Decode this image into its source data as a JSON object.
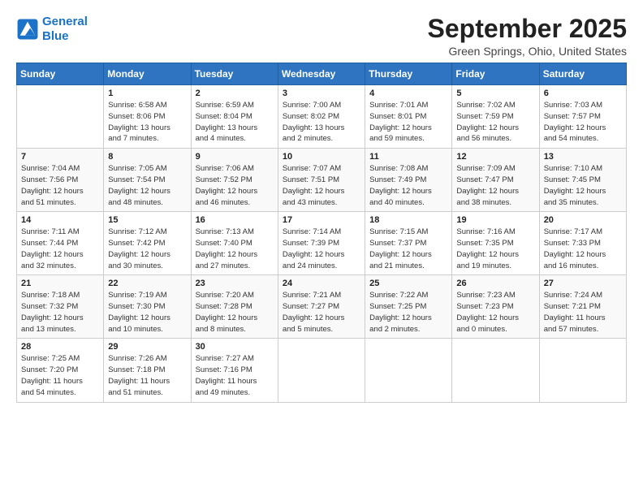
{
  "logo": {
    "line1": "General",
    "line2": "Blue"
  },
  "title": "September 2025",
  "subtitle": "Green Springs, Ohio, United States",
  "weekdays": [
    "Sunday",
    "Monday",
    "Tuesday",
    "Wednesday",
    "Thursday",
    "Friday",
    "Saturday"
  ],
  "weeks": [
    [
      {
        "day": "",
        "info": ""
      },
      {
        "day": "1",
        "info": "Sunrise: 6:58 AM\nSunset: 8:06 PM\nDaylight: 13 hours\nand 7 minutes."
      },
      {
        "day": "2",
        "info": "Sunrise: 6:59 AM\nSunset: 8:04 PM\nDaylight: 13 hours\nand 4 minutes."
      },
      {
        "day": "3",
        "info": "Sunrise: 7:00 AM\nSunset: 8:02 PM\nDaylight: 13 hours\nand 2 minutes."
      },
      {
        "day": "4",
        "info": "Sunrise: 7:01 AM\nSunset: 8:01 PM\nDaylight: 12 hours\nand 59 minutes."
      },
      {
        "day": "5",
        "info": "Sunrise: 7:02 AM\nSunset: 7:59 PM\nDaylight: 12 hours\nand 56 minutes."
      },
      {
        "day": "6",
        "info": "Sunrise: 7:03 AM\nSunset: 7:57 PM\nDaylight: 12 hours\nand 54 minutes."
      }
    ],
    [
      {
        "day": "7",
        "info": "Sunrise: 7:04 AM\nSunset: 7:56 PM\nDaylight: 12 hours\nand 51 minutes."
      },
      {
        "day": "8",
        "info": "Sunrise: 7:05 AM\nSunset: 7:54 PM\nDaylight: 12 hours\nand 48 minutes."
      },
      {
        "day": "9",
        "info": "Sunrise: 7:06 AM\nSunset: 7:52 PM\nDaylight: 12 hours\nand 46 minutes."
      },
      {
        "day": "10",
        "info": "Sunrise: 7:07 AM\nSunset: 7:51 PM\nDaylight: 12 hours\nand 43 minutes."
      },
      {
        "day": "11",
        "info": "Sunrise: 7:08 AM\nSunset: 7:49 PM\nDaylight: 12 hours\nand 40 minutes."
      },
      {
        "day": "12",
        "info": "Sunrise: 7:09 AM\nSunset: 7:47 PM\nDaylight: 12 hours\nand 38 minutes."
      },
      {
        "day": "13",
        "info": "Sunrise: 7:10 AM\nSunset: 7:45 PM\nDaylight: 12 hours\nand 35 minutes."
      }
    ],
    [
      {
        "day": "14",
        "info": "Sunrise: 7:11 AM\nSunset: 7:44 PM\nDaylight: 12 hours\nand 32 minutes."
      },
      {
        "day": "15",
        "info": "Sunrise: 7:12 AM\nSunset: 7:42 PM\nDaylight: 12 hours\nand 30 minutes."
      },
      {
        "day": "16",
        "info": "Sunrise: 7:13 AM\nSunset: 7:40 PM\nDaylight: 12 hours\nand 27 minutes."
      },
      {
        "day": "17",
        "info": "Sunrise: 7:14 AM\nSunset: 7:39 PM\nDaylight: 12 hours\nand 24 minutes."
      },
      {
        "day": "18",
        "info": "Sunrise: 7:15 AM\nSunset: 7:37 PM\nDaylight: 12 hours\nand 21 minutes."
      },
      {
        "day": "19",
        "info": "Sunrise: 7:16 AM\nSunset: 7:35 PM\nDaylight: 12 hours\nand 19 minutes."
      },
      {
        "day": "20",
        "info": "Sunrise: 7:17 AM\nSunset: 7:33 PM\nDaylight: 12 hours\nand 16 minutes."
      }
    ],
    [
      {
        "day": "21",
        "info": "Sunrise: 7:18 AM\nSunset: 7:32 PM\nDaylight: 12 hours\nand 13 minutes."
      },
      {
        "day": "22",
        "info": "Sunrise: 7:19 AM\nSunset: 7:30 PM\nDaylight: 12 hours\nand 10 minutes."
      },
      {
        "day": "23",
        "info": "Sunrise: 7:20 AM\nSunset: 7:28 PM\nDaylight: 12 hours\nand 8 minutes."
      },
      {
        "day": "24",
        "info": "Sunrise: 7:21 AM\nSunset: 7:27 PM\nDaylight: 12 hours\nand 5 minutes."
      },
      {
        "day": "25",
        "info": "Sunrise: 7:22 AM\nSunset: 7:25 PM\nDaylight: 12 hours\nand 2 minutes."
      },
      {
        "day": "26",
        "info": "Sunrise: 7:23 AM\nSunset: 7:23 PM\nDaylight: 12 hours\nand 0 minutes."
      },
      {
        "day": "27",
        "info": "Sunrise: 7:24 AM\nSunset: 7:21 PM\nDaylight: 11 hours\nand 57 minutes."
      }
    ],
    [
      {
        "day": "28",
        "info": "Sunrise: 7:25 AM\nSunset: 7:20 PM\nDaylight: 11 hours\nand 54 minutes."
      },
      {
        "day": "29",
        "info": "Sunrise: 7:26 AM\nSunset: 7:18 PM\nDaylight: 11 hours\nand 51 minutes."
      },
      {
        "day": "30",
        "info": "Sunrise: 7:27 AM\nSunset: 7:16 PM\nDaylight: 11 hours\nand 49 minutes."
      },
      {
        "day": "",
        "info": ""
      },
      {
        "day": "",
        "info": ""
      },
      {
        "day": "",
        "info": ""
      },
      {
        "day": "",
        "info": ""
      }
    ]
  ]
}
